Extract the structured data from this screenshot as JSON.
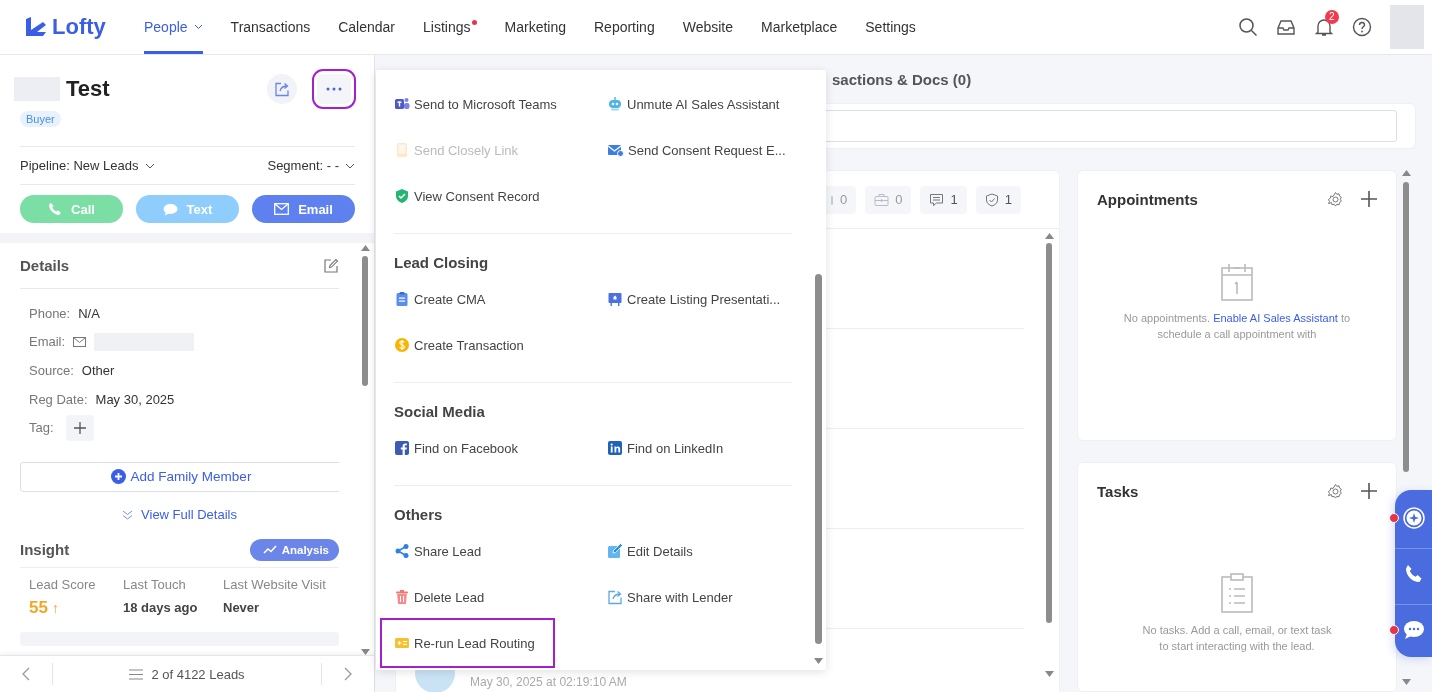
{
  "nav": {
    "logo": "Lofty",
    "items": [
      {
        "label": "People",
        "selected": true,
        "dropdown": true,
        "dot": false
      },
      {
        "label": "Transactions",
        "selected": false,
        "dropdown": false,
        "dot": false
      },
      {
        "label": "Calendar",
        "selected": false,
        "dropdown": false,
        "dot": false
      },
      {
        "label": "Listings",
        "selected": false,
        "dropdown": false,
        "dot": true
      },
      {
        "label": "Marketing",
        "selected": false,
        "dropdown": false,
        "dot": false
      },
      {
        "label": "Reporting",
        "selected": false,
        "dropdown": false,
        "dot": false
      },
      {
        "label": "Website",
        "selected": false,
        "dropdown": false,
        "dot": false
      },
      {
        "label": "Marketplace",
        "selected": false,
        "dropdown": false,
        "dot": false
      },
      {
        "label": "Settings",
        "selected": false,
        "dropdown": false,
        "dot": false
      }
    ],
    "notification_count": "2"
  },
  "lead": {
    "name": "Test",
    "tag": "Buyer",
    "more_highlighted": true,
    "pipeline": "Pipeline: New Leads",
    "segment": "Segment: - -",
    "actions": [
      {
        "kind": "call",
        "label": "Call"
      },
      {
        "kind": "text",
        "label": "Text"
      },
      {
        "kind": "email",
        "label": "Email"
      }
    ]
  },
  "details": {
    "title": "Details",
    "fields": [
      {
        "kind": "text",
        "label": "Phone:",
        "value": "N/A"
      },
      {
        "kind": "email",
        "label": "Email:"
      },
      {
        "kind": "text",
        "label": "Source:",
        "value": "Other"
      },
      {
        "kind": "text",
        "label": "Reg Date:",
        "value": "May 30, 2025"
      },
      {
        "kind": "tag",
        "label": "Tag:"
      }
    ],
    "add_family": "Add Family Member",
    "view_full": "View Full Details"
  },
  "insight": {
    "title": "Insight",
    "analysis": "Analysis",
    "stats": [
      {
        "kind": "score",
        "label": "Lead Score",
        "value": "55",
        "trend": "↑"
      },
      {
        "kind": "text",
        "label": "Last Touch",
        "value": "18 days ago"
      },
      {
        "kind": "text",
        "label": "Last Website Visit",
        "value": "Never"
      }
    ]
  },
  "pager": {
    "text": "2 of 4122 Leads"
  },
  "menu": {
    "sections": [
      {
        "items": [
          {
            "kind": "teams",
            "label": "Send to Microsoft Teams",
            "disabled": false,
            "highlighted": false
          },
          {
            "kind": "robot",
            "label": "Unmute AI Sales Assistant",
            "disabled": false,
            "highlighted": false
          },
          {
            "kind": "closely",
            "label": "Send Closely Link",
            "disabled": true,
            "highlighted": false
          },
          {
            "kind": "consent-mail",
            "label": "Send Consent Request E...",
            "disabled": false,
            "highlighted": false
          },
          {
            "kind": "shield",
            "label": "View Consent Record",
            "disabled": false,
            "highlighted": false
          }
        ]
      },
      {
        "title": "Lead Closing",
        "items": [
          {
            "kind": "cma",
            "label": "Create CMA",
            "disabled": false,
            "highlighted": false
          },
          {
            "kind": "presentation",
            "label": "Create Listing Presentati...",
            "disabled": false,
            "highlighted": false
          },
          {
            "kind": "dollar",
            "label": "Create Transaction",
            "disabled": false,
            "highlighted": false
          }
        ]
      },
      {
        "title": "Social Media",
        "items": [
          {
            "kind": "facebook",
            "label": "Find on Facebook",
            "disabled": false,
            "highlighted": false
          },
          {
            "kind": "linkedin",
            "label": "Find on LinkedIn",
            "disabled": false,
            "highlighted": false
          }
        ]
      },
      {
        "title": "Others",
        "items": [
          {
            "kind": "share",
            "label": "Share Lead",
            "disabled": false,
            "highlighted": false
          },
          {
            "kind": "edit",
            "label": "Edit Details",
            "disabled": false,
            "highlighted": false
          },
          {
            "kind": "trash",
            "label": "Delete Lead",
            "disabled": false,
            "highlighted": false
          },
          {
            "kind": "export",
            "label": "Share with Lender",
            "disabled": false,
            "highlighted": false
          },
          {
            "kind": "routing",
            "label": "Re-run Lead Routing",
            "disabled": false,
            "highlighted": true
          }
        ]
      }
    ]
  },
  "main": {
    "header": "sactions & Docs (0)",
    "counters": [
      {
        "kind": "partial",
        "count": "0"
      },
      {
        "kind": "briefcase",
        "count": "0"
      },
      {
        "kind": "message",
        "count": "1"
      },
      {
        "kind": "shield",
        "count": "1"
      }
    ],
    "activity_date": "May 30, 2025 at 02:19:10 AM"
  },
  "appointments": {
    "title": "Appointments",
    "empty_before": "No appointments.",
    "link": "Enable AI Sales Assistant",
    "empty_after": "to schedule a call appointment with"
  },
  "tasks": {
    "title": "Tasks",
    "empty_text": "No tasks. Add a call, email, or text task to start interacting with the lead."
  },
  "widget": {
    "items": [
      {
        "kind": "assistant",
        "alert": true
      },
      {
        "kind": "phone",
        "alert": false
      },
      {
        "kind": "chat",
        "alert": true
      }
    ]
  }
}
